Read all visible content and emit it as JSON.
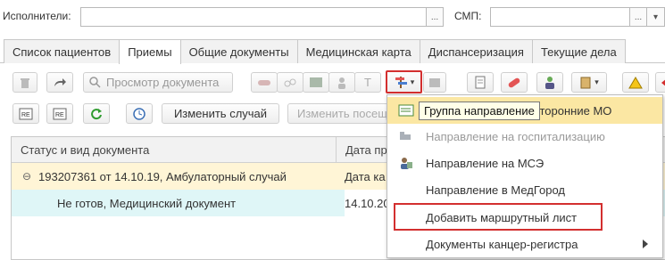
{
  "filters": {
    "executors_label": "Исполнители:",
    "executors_value": "",
    "executors_select_btn": "...",
    "smp_label": "СМП:",
    "smp_value": "",
    "smp_select_btn": "...",
    "smp_dropdown_btn": "▾"
  },
  "tabs": [
    {
      "label": "Список пациентов"
    },
    {
      "label": "Приемы"
    },
    {
      "label": "Общие документы"
    },
    {
      "label": "Медицинская карта"
    },
    {
      "label": "Диспансеризация"
    },
    {
      "label": "Текущие дела"
    }
  ],
  "toolbar": {
    "search_placeholder": "Просмотр документа",
    "change_case_label": "Изменить случай",
    "change_visit_label": "Изменить посещ",
    "text_tool_label": "T",
    "dropdown_arrow": "▾"
  },
  "grid": {
    "columns": [
      "Статус и вид документа",
      "Дата пр"
    ],
    "rows": [
      {
        "expand": "⊖",
        "status": "193207361 от 14.10.19, Амбулаторный случай",
        "date": "Дата ка"
      },
      {
        "status": "Не готов, Медицинский документ",
        "date": "14.10.20"
      }
    ]
  },
  "menu": {
    "tooltip": "Группа направление",
    "items": [
      {
        "label": "сторонние МО",
        "state": "selected"
      },
      {
        "label": "Направление на госпитализацию",
        "state": "disabled"
      },
      {
        "label": "Направление на МСЭ",
        "state": "normal"
      },
      {
        "label": "Направление в МедГород",
        "state": "normal"
      },
      {
        "label": "Добавить маршрутный лист",
        "state": "highlighted"
      },
      {
        "label": "Документы канцер-регистра",
        "state": "submenu"
      }
    ]
  },
  "colors": {
    "selected_row": "#fff5d6",
    "child_row": "#dff6f7",
    "menu_selected": "#fbe7a3",
    "highlight_border": "#d32f2f"
  }
}
